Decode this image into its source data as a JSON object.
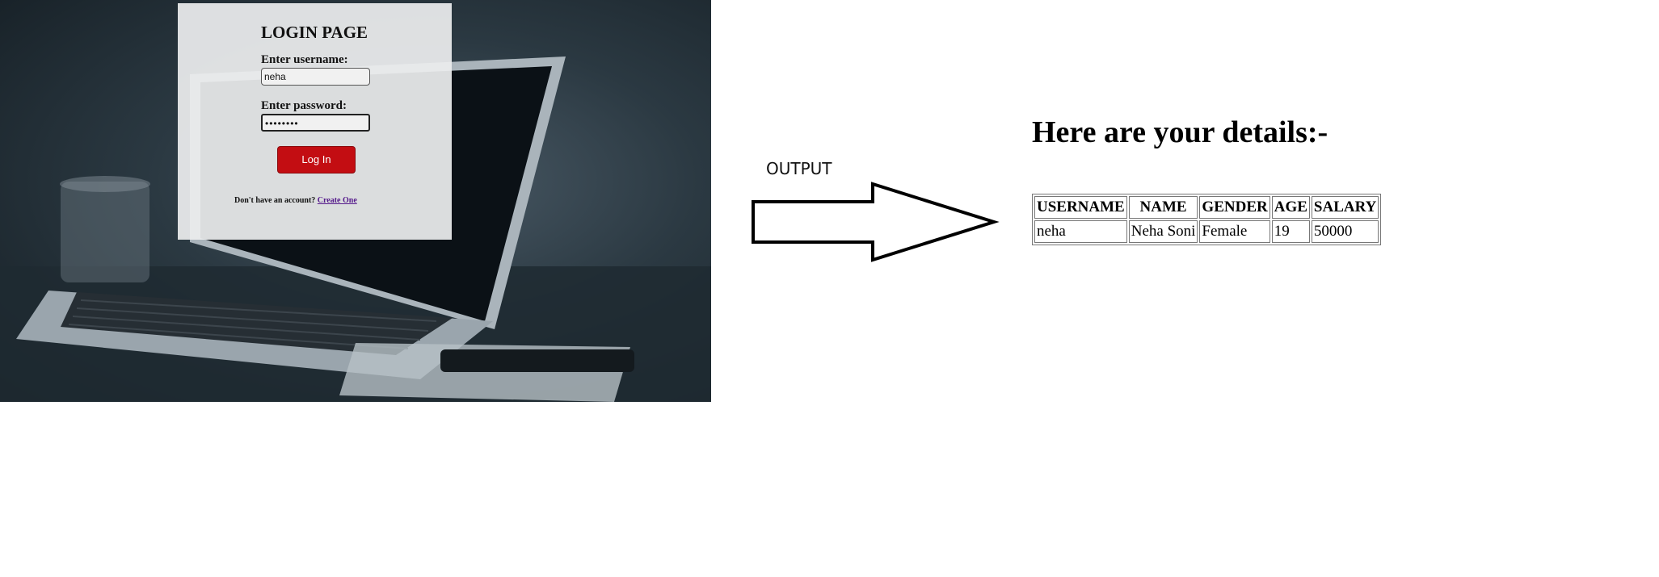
{
  "login_screen": {
    "title": "LOGIN PAGE",
    "username_label": "Enter username:",
    "username_value": "neha",
    "password_label": "Enter password:",
    "password_value": "••••••••",
    "login_button": "Log In",
    "signup_prompt": "Don't have an account?",
    "signup_link": "Create One"
  },
  "output_label": "OUTPUT",
  "result": {
    "heading": "Here are your details:-",
    "columns": [
      "USERNAME",
      "NAME",
      "GENDER",
      "AGE",
      "SALARY"
    ],
    "row": [
      "neha",
      "Neha Soni",
      "Female",
      "19",
      "50000"
    ]
  },
  "colors": {
    "login_button": "#c30d12",
    "link": "#551a8b"
  }
}
